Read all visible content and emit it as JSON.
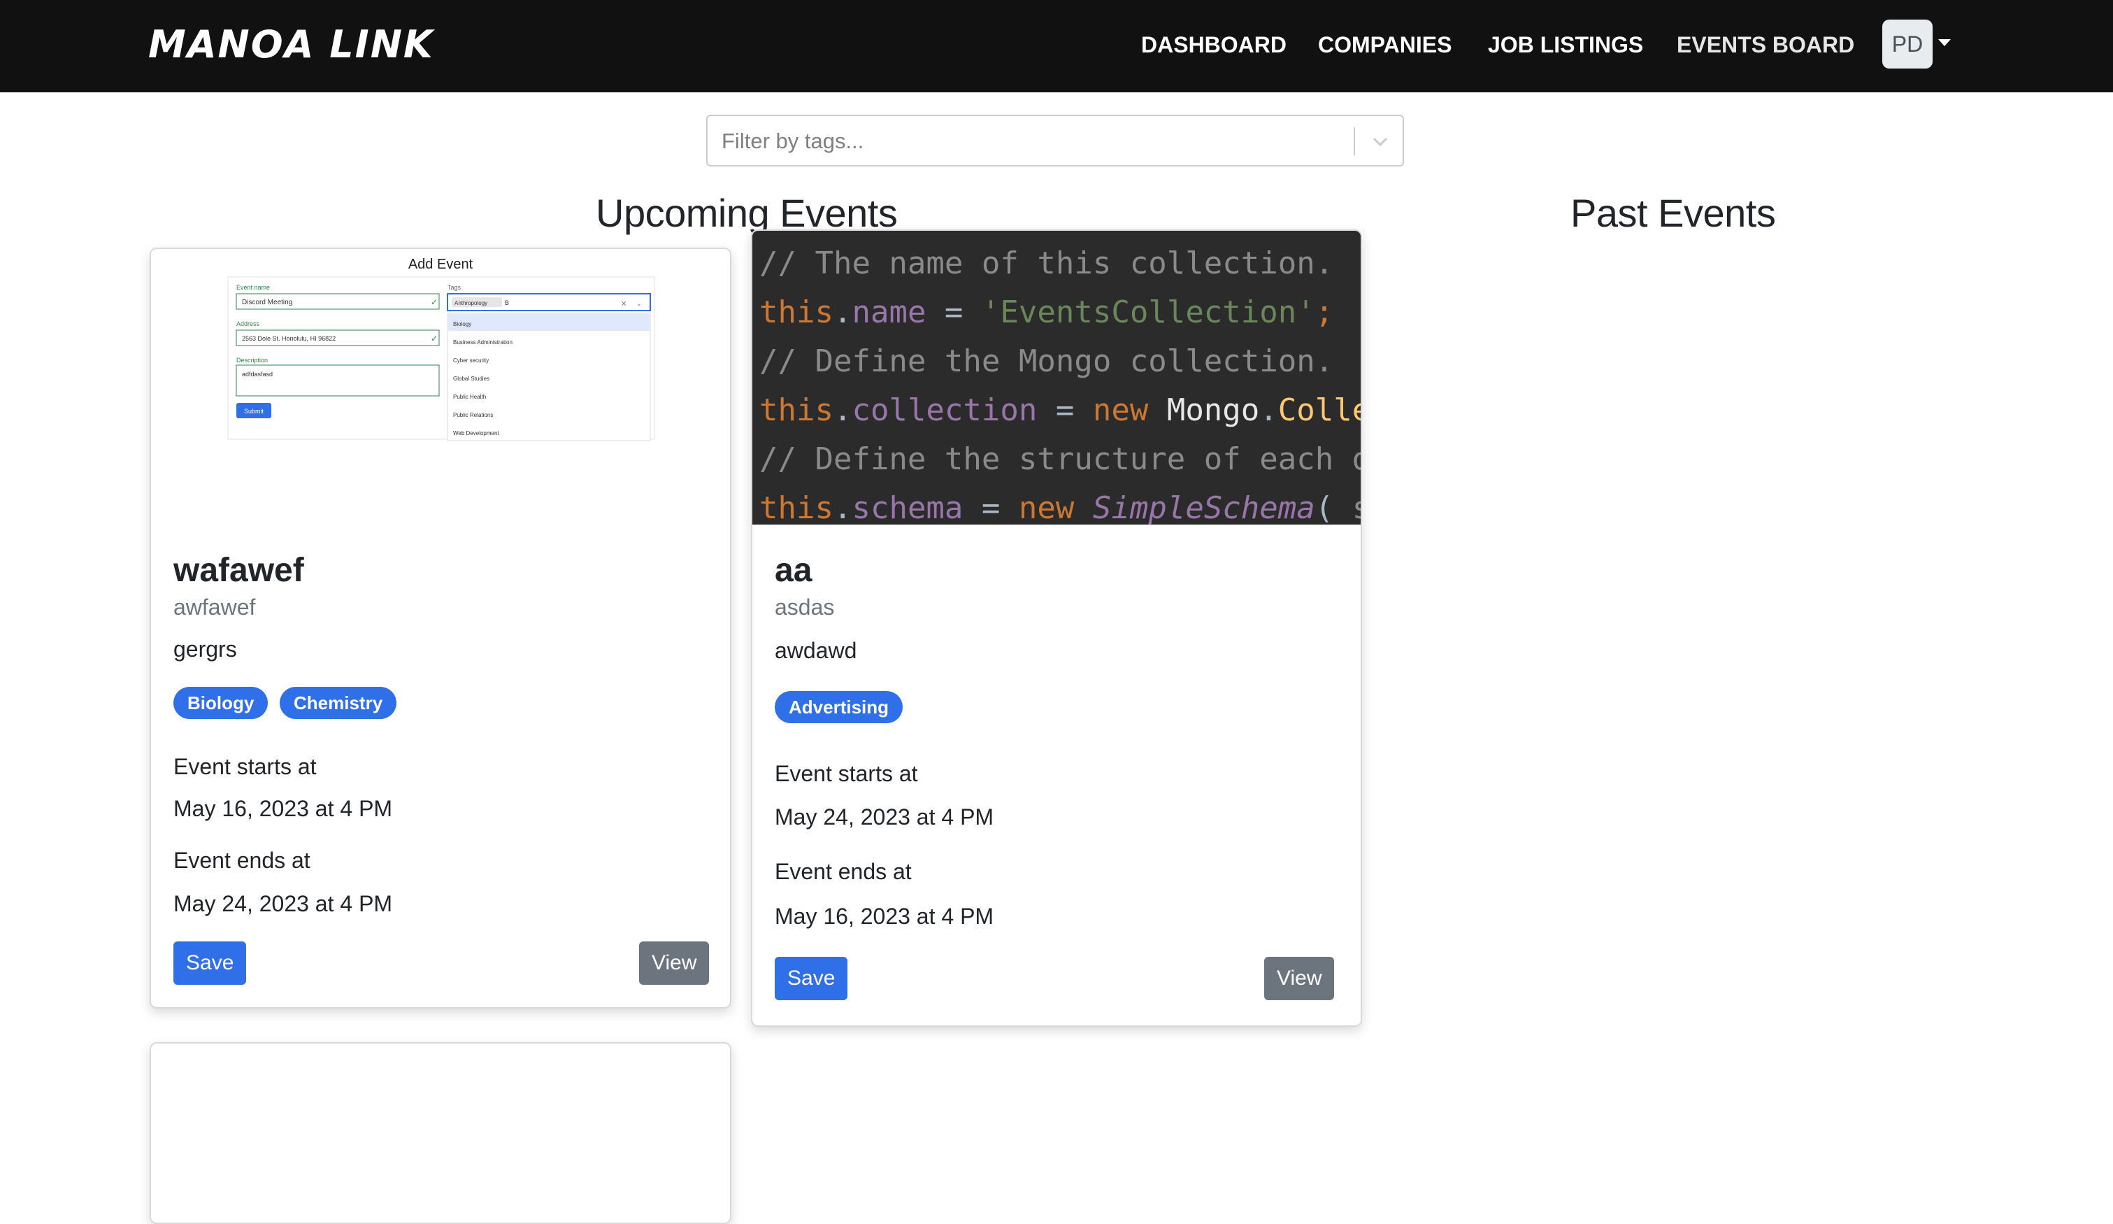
{
  "brand": {
    "name": "MANOA LINK"
  },
  "nav": {
    "items": [
      {
        "label": "DASHBOARD"
      },
      {
        "label": "COMPANIES"
      },
      {
        "label": "JOB LISTINGS"
      },
      {
        "label": "EVENTS BOARD"
      }
    ],
    "avatar_initials": "PD"
  },
  "filter": {
    "placeholder": "Filter by tags..."
  },
  "sections": {
    "upcoming": "Upcoming Events",
    "past": "Past Events"
  },
  "events": [
    {
      "title": "wafawef",
      "subtitle": "awfawef",
      "description": "gergrs",
      "tags": [
        "Biology",
        "Chemistry"
      ],
      "starts_label": "Event starts at",
      "starts_value": "May 16, 2023 at 4 PM",
      "ends_label": "Event ends at",
      "ends_value": "May 24, 2023 at 4 PM",
      "save_label": "Save",
      "view_label": "View",
      "image": {
        "heading": "Add Event",
        "event_name_label": "Event name",
        "event_name_value": "Discord Meeting",
        "address_label": "Address",
        "address_value": "2563 Dole St. Honolulu, HI 96822",
        "description_label": "Description",
        "description_value": "adfdasfasd",
        "tags_label": "Tags",
        "selected_tag": "Anthropology",
        "tag_input": "B",
        "submit_label": "Submit",
        "options": [
          "Biology",
          "Business Administration",
          "Cyber security",
          "Global Studies",
          "Public Health",
          "Public Relations",
          "Web Development"
        ]
      }
    },
    {
      "title": "aa",
      "subtitle": "asdas",
      "description": "awdawd",
      "tags": [
        "Advertising"
      ],
      "starts_label": "Event starts at",
      "starts_value": "May 24, 2023 at 4 PM",
      "ends_label": "Event ends at",
      "ends_value": "May 16, 2023 at 4 PM",
      "save_label": "Save",
      "view_label": "View",
      "image": {
        "code_lines": [
          "// The name of this collection.",
          "this.name = 'EventsCollection';",
          "// Define the Mongo collection.",
          "this.collection = new Mongo.Colle",
          "// Define the structure of each d",
          "this.schema = new SimpleSchema( sc"
        ]
      }
    }
  ]
}
